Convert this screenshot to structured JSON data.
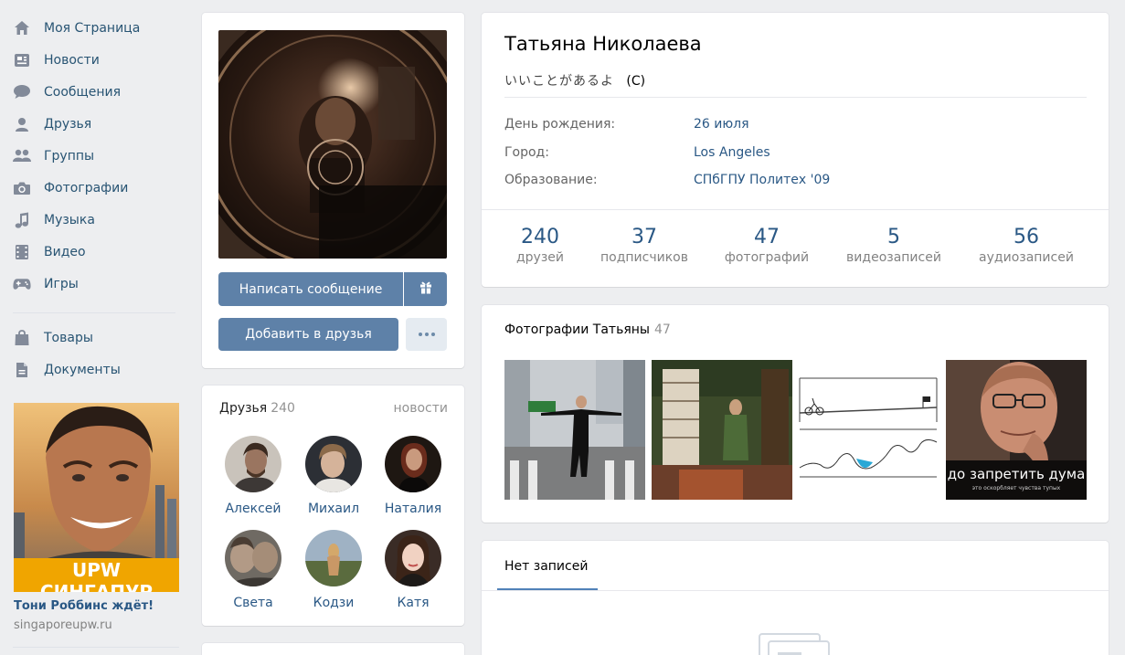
{
  "nav": {
    "items": [
      {
        "label": "Моя Страница",
        "icon": "home-icon"
      },
      {
        "label": "Новости",
        "icon": "news-icon"
      },
      {
        "label": "Сообщения",
        "icon": "messages-icon"
      },
      {
        "label": "Друзья",
        "icon": "friends-icon"
      },
      {
        "label": "Группы",
        "icon": "groups-icon"
      },
      {
        "label": "Фотографии",
        "icon": "camera-icon"
      },
      {
        "label": "Музыка",
        "icon": "music-icon"
      },
      {
        "label": "Видео",
        "icon": "video-icon"
      },
      {
        "label": "Игры",
        "icon": "gamepad-icon"
      }
    ],
    "extra_items": [
      {
        "label": "Товары",
        "icon": "bag-icon"
      },
      {
        "label": "Документы",
        "icon": "document-icon"
      }
    ]
  },
  "ad": {
    "banner_text": "UPW СИНГАПУР",
    "title": "Тони Роббинс ждёт!",
    "domain": "singaporeupw.ru"
  },
  "profile": {
    "name": "Татьяна Николаева",
    "status_jp": "いいことがあるよ",
    "status_suffix": "(C)",
    "info": [
      {
        "key": "День рождения:",
        "value": "26 июля"
      },
      {
        "key": "Город:",
        "value": "Los Angeles"
      },
      {
        "key": "Образование:",
        "value": "СПбГПУ Политех '09"
      }
    ],
    "counters": [
      {
        "num": "240",
        "label": "друзей"
      },
      {
        "num": "37",
        "label": "подписчиков"
      },
      {
        "num": "47",
        "label": "фотографий"
      },
      {
        "num": "5",
        "label": "видеозаписей"
      },
      {
        "num": "56",
        "label": "аудиозаписей"
      }
    ]
  },
  "actions": {
    "message_label": "Написать сообщение",
    "add_friend_label": "Добавить в друзья"
  },
  "friends": {
    "title": "Друзья",
    "count": "240",
    "news_link": "новости",
    "list": [
      {
        "name": "Алексей"
      },
      {
        "name": "Михаил"
      },
      {
        "name": "Наталия"
      },
      {
        "name": "Света"
      },
      {
        "name": "Кодзи"
      },
      {
        "name": "Катя"
      }
    ]
  },
  "photos": {
    "title": "Фотографии Татьяны",
    "count": "47",
    "thumb4_caption": "до запретить дума",
    "thumb4_subcaption": "это оскорбляет чувства тупых"
  },
  "wall": {
    "tab_label": "Нет записей"
  },
  "colors": {
    "link": "#2a5885",
    "button": "#5e81a8",
    "background": "#edeef0",
    "nav_icon": "#828a99"
  }
}
